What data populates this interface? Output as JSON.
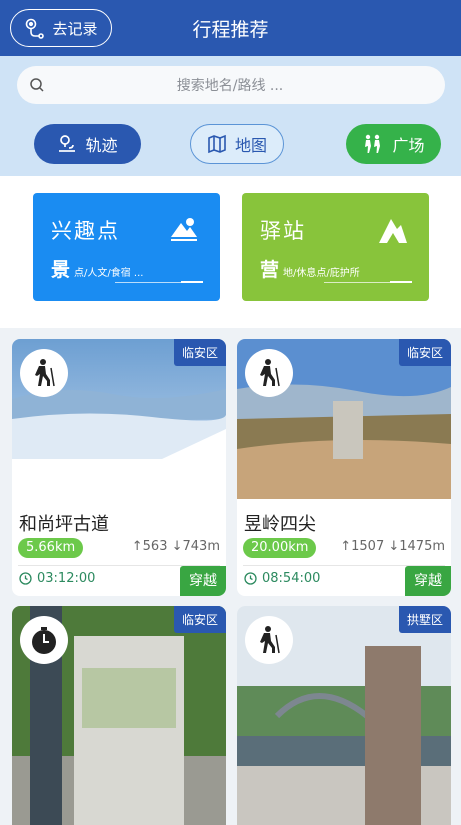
{
  "header": {
    "record_label": "去记录",
    "title": "行程推荐"
  },
  "search": {
    "placeholder": "搜索地名/路线 ..."
  },
  "modes": {
    "track": "轨迹",
    "map": "地图",
    "square": "广场"
  },
  "categories": [
    {
      "title": "兴趣点",
      "big": "景",
      "sub": "点/人文/食宿 ..."
    },
    {
      "title": "驿站",
      "big": "营",
      "sub": "地/休息点/庇护所"
    }
  ],
  "routes": [
    {
      "district": "临安区",
      "name": "和尚坪古道",
      "distance": "5.66km",
      "ascent": "↑563",
      "descent": "↓743m",
      "duration": "03:12:00",
      "type": "穿越",
      "activity_icon": "hiker-icon"
    },
    {
      "district": "临安区",
      "name": "昱岭四尖",
      "distance": "20.00km",
      "ascent": "↑1507",
      "descent": "↓1475m",
      "duration": "08:54:00",
      "type": "穿越",
      "activity_icon": "hiker-icon"
    },
    {
      "district": "临安区",
      "activity_icon": "stopwatch-icon"
    },
    {
      "district": "拱墅区",
      "activity_icon": "hiker-icon"
    }
  ]
}
